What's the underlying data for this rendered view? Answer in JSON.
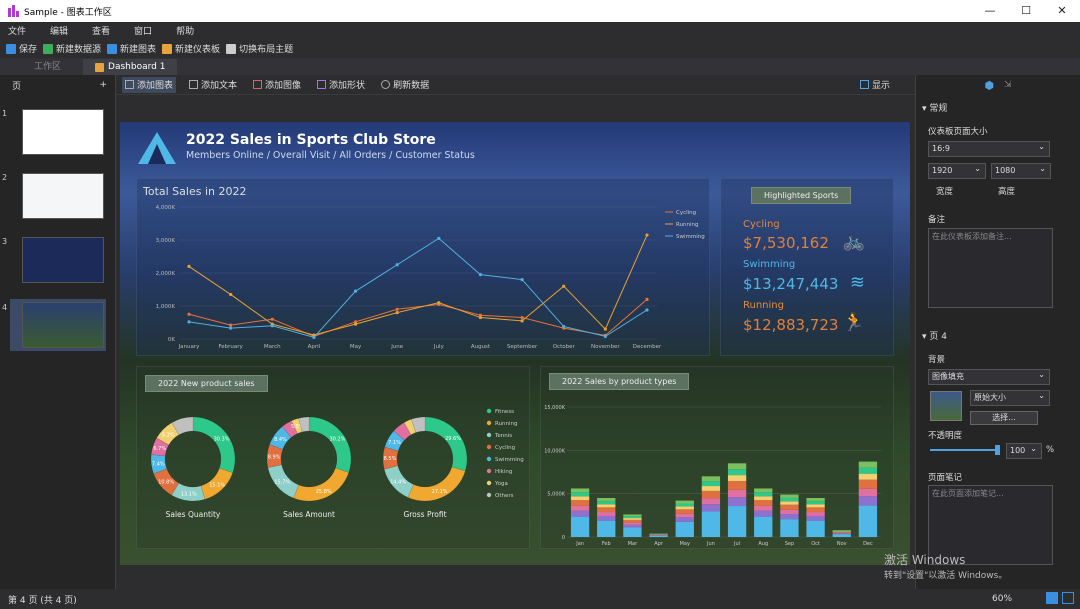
{
  "window": {
    "title": "Sample - 图表工作区",
    "minimize": "—",
    "maximize": "☐",
    "close": "✕"
  },
  "menu": [
    "文件",
    "编辑",
    "查看",
    "窗口",
    "帮助"
  ],
  "toolbar": [
    {
      "label": "保存",
      "color": "#3a8fe0"
    },
    {
      "label": "新建数据源",
      "color": "#3fae5a"
    },
    {
      "label": "新建图表",
      "color": "#3a8fe0"
    },
    {
      "label": "新建仪表板",
      "color": "#e8a33d"
    },
    {
      "label": "切换布局主题",
      "color": "#cccccc"
    }
  ],
  "tabs": {
    "workspace": "工作区",
    "dashboard": "Dashboard 1"
  },
  "left_panel": {
    "title": "页",
    "add": "+",
    "pages": [
      "1",
      "2",
      "3",
      "4"
    ]
  },
  "work_toolbar": {
    "add_chart": "添加图表",
    "add_text": "添加文本",
    "add_image": "添加图像",
    "add_shape": "添加形状",
    "refresh": "刷新数据",
    "display": "显示"
  },
  "dashboard": {
    "title": "2022 Sales in Sports Club Store",
    "subtitle": "Members Online / Overall Visit / All Orders / Customer Status",
    "total_title": "Total Sales in 2022",
    "highlight_title": "Highlighted Sports",
    "highlights": [
      {
        "label": "Cycling",
        "value": "$7,530,162",
        "icon": "bicycle-icon"
      },
      {
        "label": "Swimming",
        "value": "$13,247,443",
        "icon": "swimming-icon"
      },
      {
        "label": "Running",
        "value": "$12,883,723",
        "icon": "running-icon"
      }
    ],
    "donut_title": "2022 New product sales",
    "bar_title": "2022 Sales by product types",
    "donut_labels": [
      "Sales Quantity",
      "Sales Amount",
      "Gross Profit"
    ]
  },
  "chart_data": [
    {
      "type": "line",
      "title": "Total Sales in 2022",
      "categories": [
        "January",
        "February",
        "March",
        "April",
        "May",
        "June",
        "July",
        "August",
        "September",
        "October",
        "November",
        "December"
      ],
      "yticks": [
        "0K",
        "1,000K",
        "2,000K",
        "3,000K",
        "4,000K"
      ],
      "ylim": [
        0,
        4000
      ],
      "series": [
        {
          "name": "Cycling",
          "color": "#e8703a",
          "values": [
            750,
            420,
            600,
            80,
            520,
            900,
            1050,
            720,
            650,
            330,
            110,
            1200
          ]
        },
        {
          "name": "Running",
          "color": "#e8a030",
          "values": [
            2200,
            1350,
            450,
            120,
            450,
            800,
            1100,
            650,
            550,
            1600,
            300,
            3150
          ]
        },
        {
          "name": "Swimming",
          "color": "#4fb0e0",
          "values": [
            520,
            330,
            400,
            50,
            1450,
            2250,
            3050,
            1950,
            1800,
            380,
            80,
            880
          ]
        }
      ],
      "legend": "top-right"
    },
    {
      "type": "pie",
      "title": "Sales Quantity",
      "legend": [
        "Fitness",
        "Running",
        "Tennis",
        "Cycling",
        "Swimming",
        "Hiking",
        "Yoga",
        "Others"
      ],
      "colors": [
        "#2ec98a",
        "#f0a830",
        "#8ed0c8",
        "#e07040",
        "#4fb8e6",
        "#e070a0",
        "#f0d070",
        "#c0c0c0"
      ],
      "values": [
        30.3,
        15.1,
        13.1,
        10.8,
        7.4,
        6.7,
        8.2,
        8.4
      ],
      "labels": [
        "30.3%",
        "15.1%",
        "13.1%",
        "10.8%",
        "7.4%",
        "6.7%",
        "5.3%",
        ""
      ]
    },
    {
      "type": "pie",
      "title": "Sales Amount",
      "values": [
        30.2,
        25.8,
        15.7,
        8.9,
        8.4,
        4.2,
        2.8,
        4.0
      ],
      "labels": [
        "30.2%",
        "25.8%",
        "15.7%",
        "8.9%",
        "8.4%",
        "",
        "5.5%",
        ""
      ]
    },
    {
      "type": "pie",
      "title": "Gross Profit",
      "values": [
        29.6,
        27.1,
        14.4,
        8.5,
        7.1,
        5.0,
        3.0,
        5.3
      ],
      "labels": [
        "29.6%",
        "27.1%",
        "14.4%",
        "8.5%",
        "7.1%",
        "",
        "",
        ""
      ]
    },
    {
      "type": "bar",
      "title": "2022 Sales by product types",
      "stacked": true,
      "categories": [
        "Jan",
        "Feb",
        "Mar",
        "Apr",
        "May",
        "Jun",
        "Jul",
        "Aug",
        "Sep",
        "Oct",
        "Nov",
        "Dec"
      ],
      "yticks": [
        "0",
        "5,000K",
        "10,000K",
        "15,000K"
      ],
      "ylim": [
        0,
        15000
      ],
      "totals": [
        5600,
        4500,
        2600,
        400,
        4200,
        7000,
        8500,
        5600,
        4900,
        4500,
        800,
        8700
      ]
    }
  ],
  "right_panel": {
    "general": "常规",
    "size_label": "仪表板页面大小",
    "ratio": "16:9",
    "width": "1920",
    "height": "1080",
    "width_label": "宽度",
    "height_label": "高度",
    "notes_label": "备注",
    "notes_placeholder": "在此仪表板添加备注...",
    "page_section": "页 4",
    "bg_label": "背景",
    "bg_mode": "图像填充",
    "size_mode": "原始大小",
    "choose": "选择...",
    "opacity_label": "不透明度",
    "opacity": "100",
    "pct": "%",
    "page_notes_label": "页面笔记",
    "page_notes_placeholder": "在此页面添加笔记..."
  },
  "status": {
    "pages": "第 4 页 (共 4 页)",
    "zoom": "60%"
  },
  "watermark": {
    "line1": "激活 Windows",
    "line2": "转到\"设置\"以激活 Windows。"
  }
}
